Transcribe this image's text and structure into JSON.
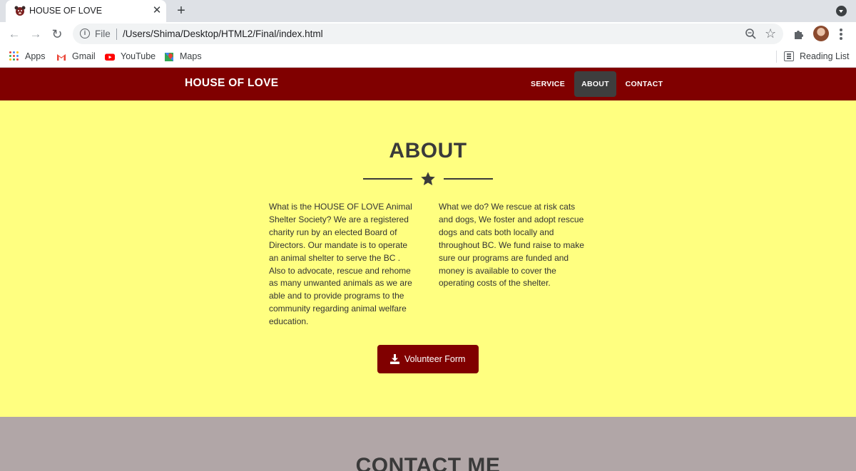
{
  "browser": {
    "tab": {
      "title": "HOUSE OF LOVE",
      "favicon": "dog-face-icon"
    },
    "address": {
      "scheme": "File",
      "url": "/Users/Shima/Desktop/HTML2/Final/index.html"
    },
    "bookmarks": [
      {
        "label": "Apps",
        "icon": "apps-grid-icon"
      },
      {
        "label": "Gmail",
        "icon": "gmail-icon"
      },
      {
        "label": "YouTube",
        "icon": "youtube-icon"
      },
      {
        "label": "Maps",
        "icon": "maps-icon"
      }
    ],
    "reading_list": "Reading List"
  },
  "site": {
    "brand": "HOUSE OF LOVE",
    "nav": [
      {
        "label": "SERVICE",
        "active": false
      },
      {
        "label": "ABOUT",
        "active": true
      },
      {
        "label": "CONTACT",
        "active": false
      }
    ],
    "colors": {
      "nav_bg": "#800000",
      "about_bg": "#ffff80",
      "contact_bg": "#b1a6a7",
      "active_nav": "#3e3e3e"
    }
  },
  "about": {
    "title": "ABOUT",
    "divider_icon": "star-icon",
    "left_text": "What is the HOUSE OF LOVE Animal Shelter Society? We are a registered charity run by an elected Board of Directors. Our mandate is to operate an animal shelter to serve the BC . Also to advocate, rescue and rehome as many unwanted animals as we are able and to provide programs to the community regarding animal welfare education.",
    "right_text": "What we do? We rescue at risk cats and dogs, We foster and adopt rescue dogs and cats both locally and throughout BC. We fund raise to make sure our programs are funded and money is available to cover the operating costs of the shelter.",
    "button": {
      "label": "Volunteer Form",
      "icon": "download-icon"
    }
  },
  "contact": {
    "title": "CONTACT ME"
  }
}
